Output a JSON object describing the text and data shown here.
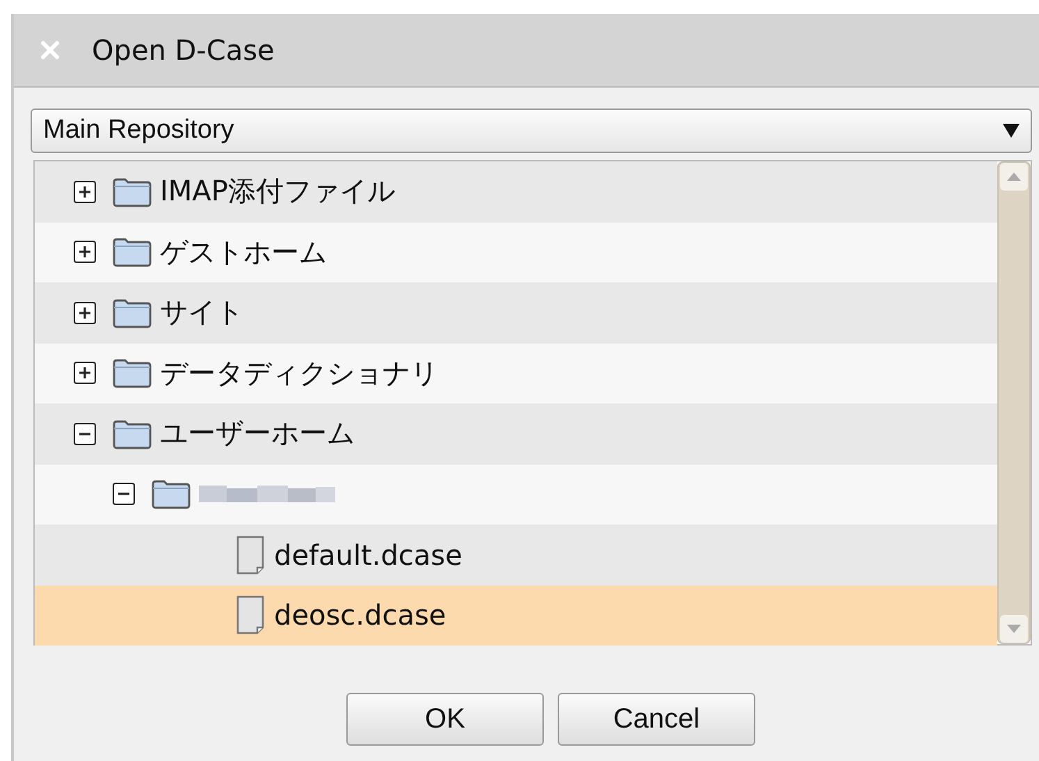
{
  "window": {
    "title": "Open D-Case"
  },
  "repository": {
    "value": "Main Repository"
  },
  "tree": [
    {
      "label": "IMAP添付ファイル",
      "kind": "folder",
      "expanded": false,
      "selected": false
    },
    {
      "label": "ゲストホーム",
      "kind": "folder",
      "expanded": false,
      "selected": false
    },
    {
      "label": "サイト",
      "kind": "folder",
      "expanded": false,
      "selected": false
    },
    {
      "label": "データディクショナリ",
      "kind": "folder",
      "expanded": false,
      "selected": false
    },
    {
      "label": "ユーザーホーム",
      "kind": "folder",
      "expanded": true,
      "selected": false,
      "children": [
        {
          "kind": "folder",
          "expanded": true,
          "selected": false,
          "label_hidden": true,
          "children": [
            {
              "label": "default.dcase",
              "kind": "file",
              "selected": false
            },
            {
              "label": "deosc.dcase",
              "kind": "file",
              "selected": true
            }
          ]
        }
      ]
    }
  ],
  "buttons": [
    "OK",
    "Cancel"
  ]
}
